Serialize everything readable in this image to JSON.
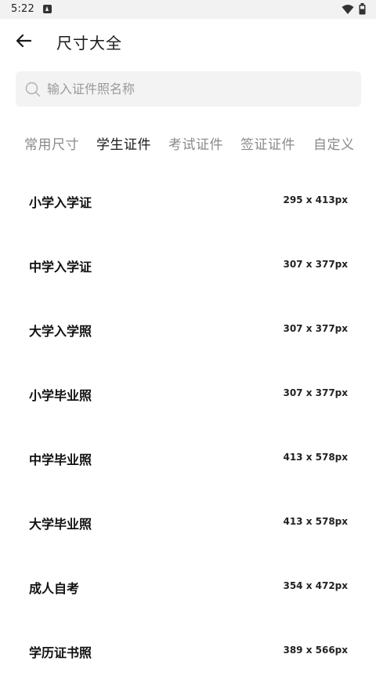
{
  "status_bar": {
    "time": "5:22",
    "icons": [
      "notification-icon",
      "wifi-icon",
      "battery-icon"
    ]
  },
  "app_bar": {
    "back_icon": "arrow-left-icon",
    "title": "尺寸大全"
  },
  "search": {
    "icon": "search-icon",
    "placeholder": "输入证件照名称",
    "value": ""
  },
  "tabs": [
    {
      "label": "常用尺寸",
      "active": false
    },
    {
      "label": "学生证件",
      "active": true
    },
    {
      "label": "考试证件",
      "active": false
    },
    {
      "label": "签证证件",
      "active": false
    },
    {
      "label": "自定义",
      "active": false
    }
  ],
  "sizes": [
    {
      "name": "小学入学证",
      "dimensions": "295 x 413px"
    },
    {
      "name": "中学入学证",
      "dimensions": "307 x 377px"
    },
    {
      "name": "大学入学照",
      "dimensions": "307 x 377px"
    },
    {
      "name": "小学毕业照",
      "dimensions": "307 x 377px"
    },
    {
      "name": "中学毕业照",
      "dimensions": "413 x 578px"
    },
    {
      "name": "大学毕业照",
      "dimensions": "413 x 578px"
    },
    {
      "name": "成人自考",
      "dimensions": "354 x 472px"
    },
    {
      "name": "学历证书照",
      "dimensions": "389 x 566px"
    }
  ],
  "colors": {
    "background": "#ffffff",
    "search_bg": "#f3f3f3",
    "tab_active": "#1a1a1a",
    "tab_inactive": "#8a8a8a"
  }
}
